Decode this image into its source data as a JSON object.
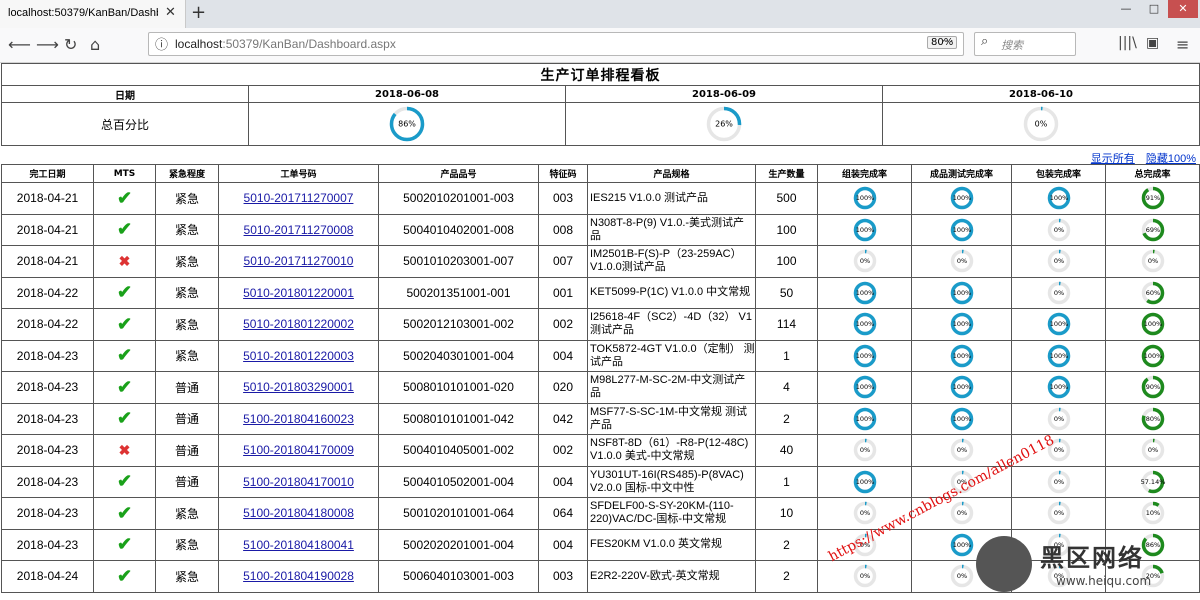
{
  "browser": {
    "tab_title": "localhost:50379/KanBan/Dashboard",
    "url_host": "localhost",
    "url_rest": ":50379/KanBan/Dashboard.aspx",
    "zoom": "80%",
    "search_placeholder": "搜索"
  },
  "title": "生产订单排程看板",
  "summary": {
    "date_label": "日期",
    "total_label": "总百分比",
    "dates": [
      "2018-06-08",
      "2018-06-09",
      "2018-06-10"
    ],
    "percents": [
      86,
      26,
      0
    ],
    "percent_labels": [
      "86%",
      "26%",
      "0%"
    ]
  },
  "links": {
    "show_all": "显示所有",
    "hide_100": "隐藏100%"
  },
  "columns": [
    "完工日期",
    "MTS",
    "紧急程度",
    "工单号码",
    "产品品号",
    "特征码",
    "产品规格",
    "生产数量",
    "组装完成率",
    "成品测试完成率",
    "包装完成率",
    "总完成率"
  ],
  "rows": [
    {
      "date": "2018-04-21",
      "mts": true,
      "urgency": "紧急",
      "wo": "5010-201711270007",
      "part": "5002010201001-003",
      "code": "003",
      "spec": "IES215 V1.0.0 测试产品",
      "qty": "500",
      "asm": 100,
      "asm_t": "100%",
      "test": 100,
      "test_t": "100%",
      "pack": 100,
      "pack_t": "100%",
      "total": 91,
      "total_t": "91%"
    },
    {
      "date": "2018-04-21",
      "mts": true,
      "urgency": "紧急",
      "wo": "5010-201711270008",
      "part": "5004010402001-008",
      "code": "008",
      "spec": "N308T-8-P(9) V1.0.-美式测试产品",
      "qty": "100",
      "asm": 100,
      "asm_t": "100%",
      "test": 100,
      "test_t": "100%",
      "pack": 0,
      "pack_t": "0%",
      "total": 69,
      "total_t": "69%"
    },
    {
      "date": "2018-04-21",
      "mts": false,
      "urgency": "紧急",
      "wo": "5010-201711270010",
      "part": "5001010203001-007",
      "code": "007",
      "spec": "IM2501B-F(S)-P（23-259AC）V1.0.0测试产品",
      "qty": "100",
      "asm": 0,
      "asm_t": "0%",
      "test": 0,
      "test_t": "0%",
      "pack": 0,
      "pack_t": "0%",
      "total": 0,
      "total_t": "0%"
    },
    {
      "date": "2018-04-22",
      "mts": true,
      "urgency": "紧急",
      "wo": "5010-201801220001",
      "part": "500201351001-001",
      "code": "001",
      "spec": "KET5099-P(1C) V1.0.0 中文常规",
      "qty": "50",
      "asm": 100,
      "asm_t": "100%",
      "test": 100,
      "test_t": "100%",
      "pack": 0,
      "pack_t": "0%",
      "total": 60,
      "total_t": "60%"
    },
    {
      "date": "2018-04-22",
      "mts": true,
      "urgency": "紧急",
      "wo": "5010-201801220002",
      "part": "5002012103001-002",
      "code": "002",
      "spec": "I25618-4F（SC2）-4D（32） V1 测试产品",
      "qty": "114",
      "asm": 100,
      "asm_t": "100%",
      "test": 100,
      "test_t": "100%",
      "pack": 100,
      "pack_t": "100%",
      "total": 100,
      "total_t": "100%"
    },
    {
      "date": "2018-04-23",
      "mts": true,
      "urgency": "紧急",
      "wo": "5010-201801220003",
      "part": "5002040301001-004",
      "code": "004",
      "spec": "TOK5872-4GT V1.0.0（定制） 测试产品",
      "qty": "1",
      "asm": 100,
      "asm_t": "100%",
      "test": 100,
      "test_t": "100%",
      "pack": 100,
      "pack_t": "100%",
      "total": 100,
      "total_t": "100%"
    },
    {
      "date": "2018-04-23",
      "mts": true,
      "urgency": "普通",
      "wo": "5010-201803290001",
      "part": "5008010101001-020",
      "code": "020",
      "spec": "M98L277-M-SC-2M-中文测试产品",
      "qty": "4",
      "asm": 100,
      "asm_t": "100%",
      "test": 100,
      "test_t": "100%",
      "pack": 100,
      "pack_t": "100%",
      "total": 90,
      "total_t": "90%"
    },
    {
      "date": "2018-04-23",
      "mts": true,
      "urgency": "普通",
      "wo": "5100-201804160023",
      "part": "5008010101001-042",
      "code": "042",
      "spec": "MSF77-S-SC-1M-中文常规 测试产品",
      "qty": "2",
      "asm": 100,
      "asm_t": "100%",
      "test": 100,
      "test_t": "100%",
      "pack": 0,
      "pack_t": "0%",
      "total": 80,
      "total_t": "80%"
    },
    {
      "date": "2018-04-23",
      "mts": false,
      "urgency": "普通",
      "wo": "5100-201804170009",
      "part": "5004010405001-002",
      "code": "002",
      "spec": "NSF8T-8D（61）-R8-P(12-48C) V1.0.0 美式-中文常规",
      "qty": "40",
      "asm": 0,
      "asm_t": "0%",
      "test": 0,
      "test_t": "0%",
      "pack": 0,
      "pack_t": "0%",
      "total": 0,
      "total_t": "0%"
    },
    {
      "date": "2018-04-23",
      "mts": true,
      "urgency": "普通",
      "wo": "5100-201804170010",
      "part": "5004010502001-004",
      "code": "004",
      "spec": "YU301UT-16I(RS485)-P(8VAC) V2.0.0 国标-中文中性",
      "qty": "1",
      "asm": 100,
      "asm_t": "100%",
      "test": 0,
      "test_t": "0%",
      "pack": 0,
      "pack_t": "0%",
      "total": 57,
      "total_t": "57.14%"
    },
    {
      "date": "2018-04-23",
      "mts": true,
      "urgency": "紧急",
      "wo": "5100-201804180008",
      "part": "5001020101001-064",
      "code": "064",
      "spec": "SFDELF00-S-SY-20KM-(110-220)VAC/DC-国标-中文常规",
      "qty": "10",
      "asm": 0,
      "asm_t": "0%",
      "test": 0,
      "test_t": "0%",
      "pack": 0,
      "pack_t": "0%",
      "total": 10,
      "total_t": "10%"
    },
    {
      "date": "2018-04-23",
      "mts": true,
      "urgency": "紧急",
      "wo": "5100-201804180041",
      "part": "5002020201001-004",
      "code": "004",
      "spec": "FES20KM V1.0.0 英文常规",
      "qty": "2",
      "asm": 0,
      "asm_t": "0%",
      "test": 100,
      "test_t": "100%",
      "pack": 0,
      "pack_t": "0%",
      "total": 86,
      "total_t": "86%"
    },
    {
      "date": "2018-04-24",
      "mts": true,
      "urgency": "紧急",
      "wo": "5100-201804190028",
      "part": "5006040103001-003",
      "code": "003",
      "spec": "E2R2-220V-欧式-英文常规",
      "qty": "2",
      "asm": 0,
      "asm_t": "0%",
      "test": 0,
      "test_t": "0%",
      "pack": 0,
      "pack_t": "0%",
      "total": 20,
      "total_t": "20%"
    }
  ],
  "watermark": {
    "url": "https://www.cnblogs.com/allen0118",
    "brand": "黑区网络",
    "site": "www.heiqu.com"
  },
  "colors": {
    "ring_blue": "#1a9bc9",
    "ring_green": "#1e8a1e",
    "ring_track": "#e6e6e6",
    "check": "#1aa11a",
    "cross": "#d33333"
  }
}
